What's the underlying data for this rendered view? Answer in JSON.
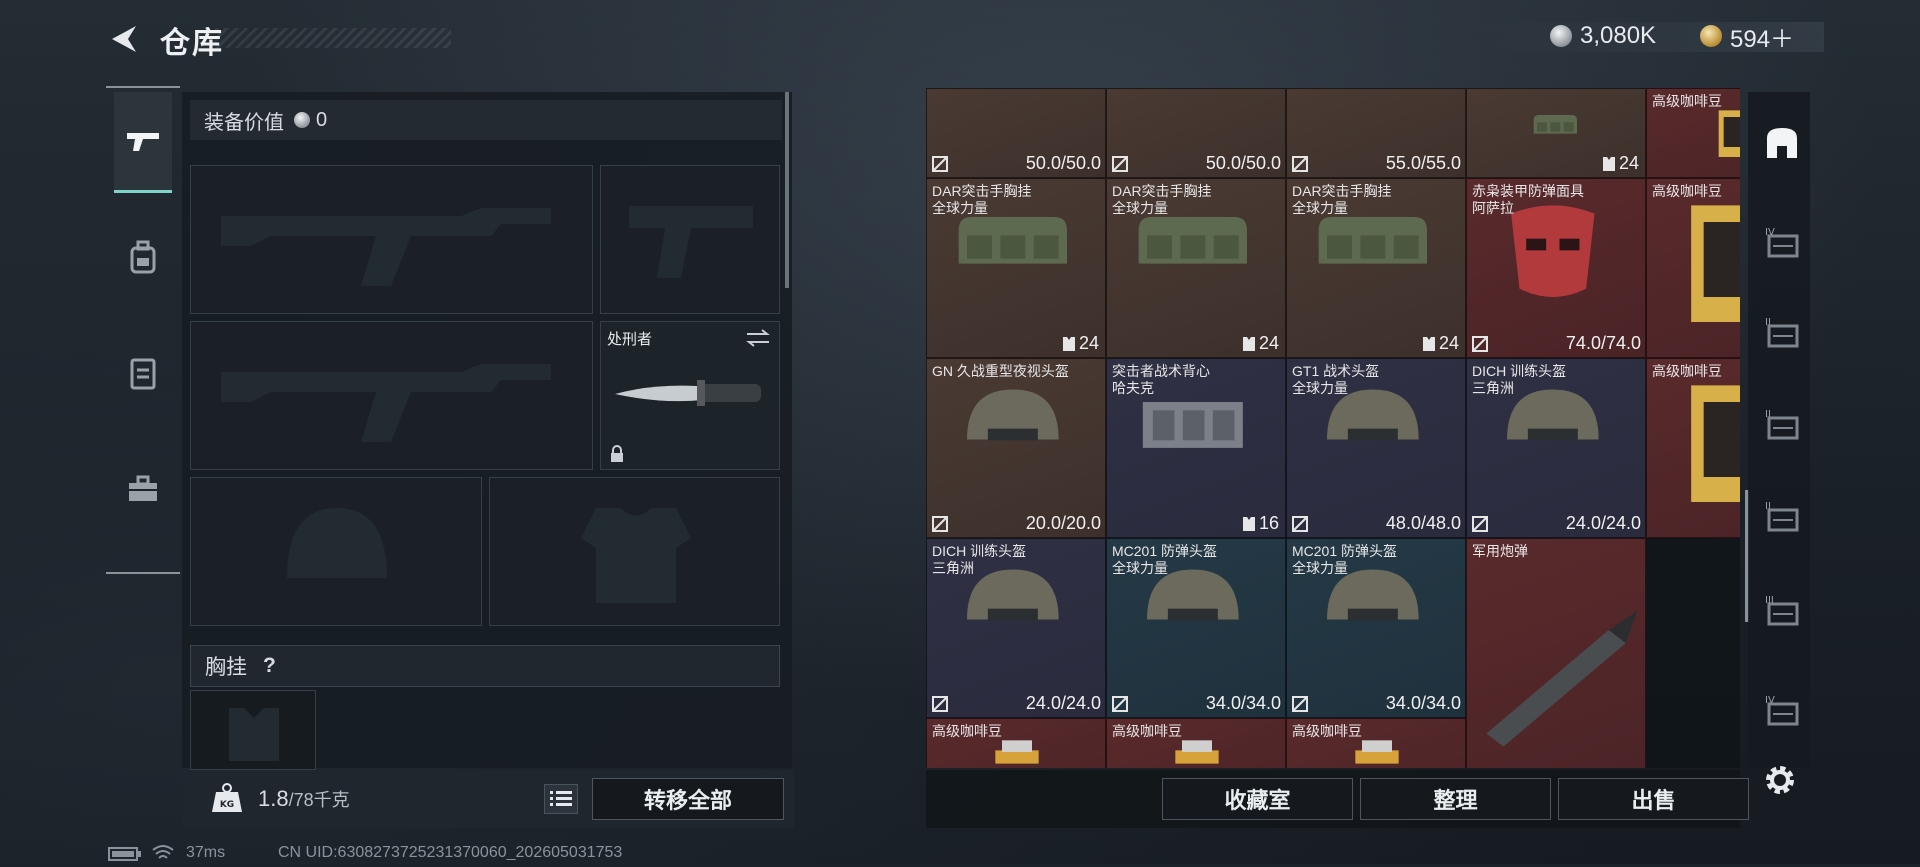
{
  "header": {
    "title": "仓库"
  },
  "currency": {
    "silver": "3,080K",
    "gold": "594＋"
  },
  "categories": [
    {
      "name": "firearm",
      "active": true
    },
    {
      "name": "backpack",
      "active": false
    },
    {
      "name": "vest",
      "active": false
    },
    {
      "name": "toolbox",
      "active": false
    }
  ],
  "equip": {
    "value_label": "装备价值",
    "value": "0",
    "knife_label": "处刑者",
    "chest_label": "胸挂",
    "chest_help": "?"
  },
  "weight": {
    "current": "1.8",
    "max": "/78千克"
  },
  "buttons": {
    "transfer_all": "转移全部",
    "collection": "收藏室",
    "sort": "整理",
    "sell": "出售"
  },
  "status": {
    "ping": "37ms",
    "uid": "CN UID:63082737252313700​60_202605031753"
  },
  "inventory": [
    {
      "name": "",
      "value": "50.0/50.0",
      "color": "brown"
    },
    {
      "name": "",
      "value": "50.0/50.0",
      "color": "brown"
    },
    {
      "name": "",
      "value": "55.0/55.0",
      "color": "brown"
    },
    {
      "name": "",
      "stack": "24",
      "color": "brown"
    },
    {
      "name": "DAR突击手胸挂\n全球力量",
      "stack": "24",
      "color": "brown"
    },
    {
      "name": "DAR突击手胸挂\n全球力量",
      "stack": "24",
      "color": "brown"
    },
    {
      "name": "DAR突击手胸挂\n全球力量",
      "stack": "24",
      "color": "brown"
    },
    {
      "name": "赤枭装甲防弹面具\n阿萨拉",
      "value": "74.0/74.0",
      "color": "red"
    },
    {
      "name": "GN 久战重型夜视头盔",
      "value": "20.0/20.0",
      "color": "brown"
    },
    {
      "name": "突击者战术背心\n哈夫克",
      "stack": "16",
      "color": "purple"
    },
    {
      "name": "GT1 战术头盔\n全球力量",
      "value": "48.0/48.0",
      "color": "purple"
    },
    {
      "name": "DICH 训练头盔\n三角洲",
      "value": "24.0/24.0",
      "color": "purple"
    },
    {
      "name": "DICH 训练头盔\n三角洲",
      "value": "24.0/24.0",
      "color": "purple"
    },
    {
      "name": "MC201 防弹头盔\n全球力量",
      "value": "34.0/34.0",
      "color": "blue"
    },
    {
      "name": "MC201 防弹头盔\n全球力量",
      "value": "34.0/34.0",
      "color": "blue"
    },
    {
      "name": "军用炮弹",
      "value": "",
      "color": "red"
    },
    {
      "name": "高级咖啡豆",
      "value": "",
      "color": "red"
    },
    {
      "name": "高级咖啡豆",
      "value": "",
      "color": "red"
    },
    {
      "name": "高级咖啡豆",
      "value": "",
      "color": "red"
    },
    {
      "name": "高级咖啡豆",
      "value": "",
      "color": "red"
    },
    {
      "name": "高级咖啡豆",
      "value": "",
      "color": "red"
    },
    {
      "name": "高级咖啡豆",
      "value": "",
      "color": "red"
    }
  ],
  "sidebar": [
    {
      "icon": "storage-icon",
      "label": ""
    },
    {
      "icon": "shelf-iv-icon",
      "label": "IV"
    },
    {
      "icon": "shelf-ii-icon",
      "label": "II"
    },
    {
      "icon": "shelf-ii-b-icon",
      "label": "II"
    },
    {
      "icon": "shelf-ii-c-icon",
      "label": "II"
    },
    {
      "icon": "shelf-iii-icon",
      "label": "III"
    },
    {
      "icon": "shelf-iv-add-icon",
      "label": "IV"
    }
  ],
  "colors": {
    "accent": "#7fd3c8",
    "brown": "#4a3a33",
    "purple": "#2f3044",
    "blue": "#253946",
    "red": "#5a2a2c"
  }
}
